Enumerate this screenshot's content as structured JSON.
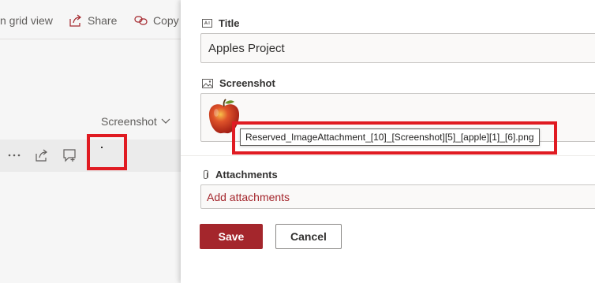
{
  "list_pane": {
    "commands": [
      {
        "label": "n grid view",
        "icon": "grid-icon"
      },
      {
        "label": "Share",
        "icon": "share-icon"
      },
      {
        "label": "Copy",
        "icon": "link-icon"
      }
    ],
    "column_header": "Screenshot",
    "row_icons": [
      "more-icon",
      "share-icon",
      "comment-icon"
    ]
  },
  "form": {
    "title": {
      "label": "Title",
      "value": "Apples Project"
    },
    "screenshot": {
      "label": "Screenshot",
      "tooltip": "Reserved_ImageAttachment_[10]_[Screenshot][5]_[apple][1]_[6].png"
    },
    "attachments": {
      "label": "Attachments",
      "link": "Add attachments"
    },
    "buttons": {
      "save": "Save",
      "cancel": "Cancel"
    }
  },
  "colors": {
    "accent": "#a4262c",
    "highlight": "#e01b22",
    "list_background": "#f6f6f6"
  }
}
